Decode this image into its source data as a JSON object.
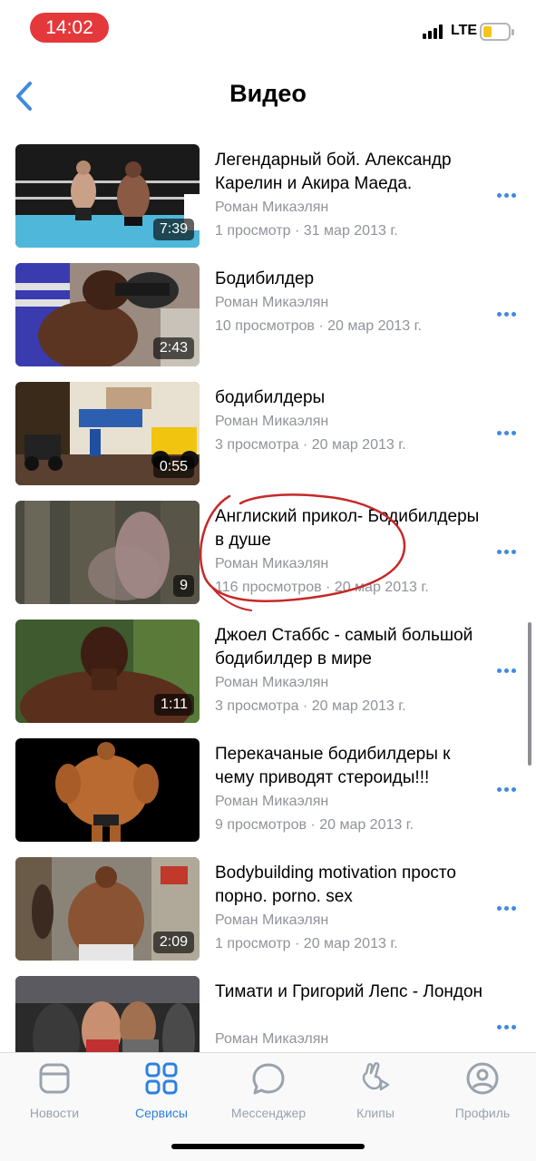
{
  "status_bar": {
    "time": "14:02",
    "network": "LTE"
  },
  "header": {
    "title": "Видео"
  },
  "videos": [
    {
      "title": "Легендарный бой. Александр Карелин и Акира Маеда.",
      "author": "Роман Микаэлян",
      "stats": "1 просмотр · 31 мар 2013 г.",
      "duration": "7:39"
    },
    {
      "title": "Бодибилдер",
      "author": "Роман Микаэлян",
      "stats": "10 просмотров · 20 мар 2013 г.",
      "duration": "2:43"
    },
    {
      "title": "бодибилдеры",
      "author": "Роман Микаэлян",
      "stats": "3 просмотра · 20 мар 2013 г.",
      "duration": "0:55"
    },
    {
      "title": "Англиский прикол- Бодибилдеры в душе",
      "author": "Роман Микаэлян",
      "stats": "116 просмотров · 20 мар 2013 г.",
      "duration": "9"
    },
    {
      "title": "Джоел Стаббс - самый большой бодибилдер в мире",
      "author": "Роман Микаэлян",
      "stats": "3 просмотра · 20 мар 2013 г.",
      "duration": "1:11"
    },
    {
      "title": "Перекачаные бодибилдеры к чему приводят стероиды!!!",
      "author": "Роман Микаэлян",
      "stats": "9 просмотров · 20 мар 2013 г.",
      "duration": ""
    },
    {
      "title": "Bodybuilding motivation просто порно. porno. sex",
      "author": "Роман Микаэлян",
      "stats": "1 просмотр · 20 мар 2013 г.",
      "duration": "2:09"
    },
    {
      "title": "Тимати и Григорий Лепс - Лондон",
      "author": "Роман Микаэлян",
      "stats": "",
      "duration": ""
    }
  ],
  "tabbar": {
    "tabs": [
      {
        "label": "Новости",
        "icon": "news-icon"
      },
      {
        "label": "Сервисы",
        "icon": "services-icon",
        "active": true
      },
      {
        "label": "Мессенджер",
        "icon": "messenger-icon"
      },
      {
        "label": "Клипы",
        "icon": "clips-icon"
      },
      {
        "label": "Профиль",
        "icon": "profile-icon"
      }
    ]
  },
  "colors": {
    "accent": "#2d81e0",
    "more_dots": "#3f8ae0",
    "meta_text": "#909399",
    "time_pill": "#e5383b",
    "annotation": "#c62828"
  }
}
